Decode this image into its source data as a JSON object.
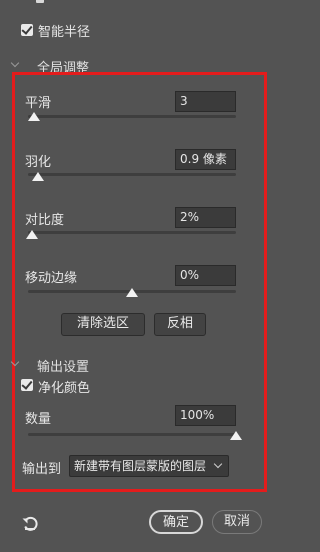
{
  "smart_radius": {
    "label": "智能半径",
    "checked": true
  },
  "global_adjust": {
    "title": "全局调整",
    "smooth": {
      "label": "平滑",
      "value": "3",
      "slider": 0.0
    },
    "feather": {
      "label": "羽化",
      "value": "0.9 像素",
      "slider": 0.02
    },
    "contrast": {
      "label": "对比度",
      "value": "2%",
      "slider": 0.0
    },
    "shift_edge": {
      "label": "移动边缘",
      "value": "0%",
      "slider": 0.5
    },
    "clear_selection": "清除选区",
    "invert": "反相"
  },
  "output": {
    "title": "输出设置",
    "decontaminate": {
      "label": "净化颜色",
      "checked": true
    },
    "amount": {
      "label": "数量",
      "value": "100%",
      "slider": 1.0
    },
    "output_to_label": "输出到",
    "output_to_value": "新建带有图层蒙版的图层"
  },
  "footer": {
    "ok": "确定",
    "cancel": "取消"
  },
  "icons": {
    "reset": "reset-icon",
    "chevron": "chevron-down-icon",
    "checkbox": "check-icon"
  },
  "colors": {
    "highlight_border": "#e41c1c",
    "panel_bg": "#535353"
  }
}
